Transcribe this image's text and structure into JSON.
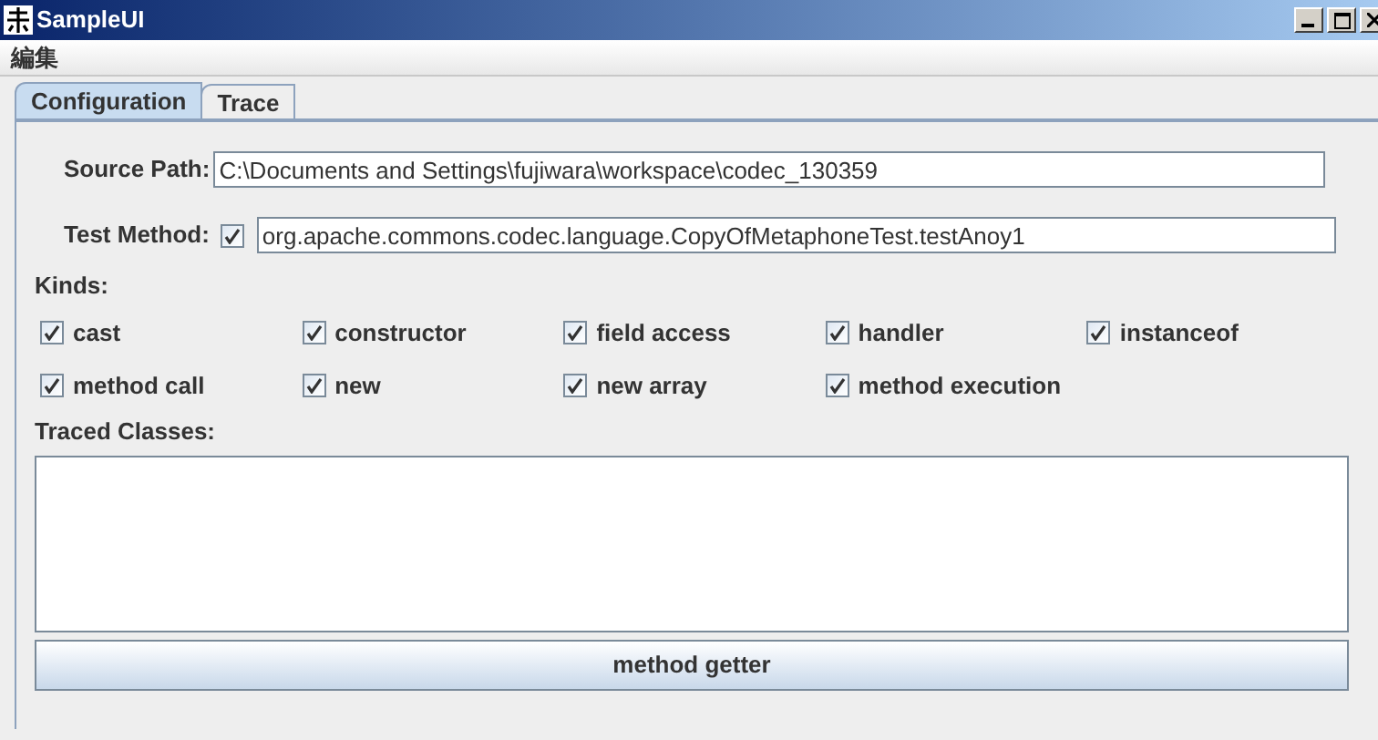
{
  "window": {
    "title": "SampleUI"
  },
  "menu": [
    "編集"
  ],
  "tabs": [
    {
      "label": "Configuration",
      "selected": true
    },
    {
      "label": "Trace",
      "selected": false
    }
  ],
  "source_path": {
    "label": "Source Path:",
    "value": "C:\\Documents and Settings\\fujiwara\\workspace\\codec_130359"
  },
  "test_method": {
    "label": "Test Method:",
    "checked": true,
    "value": "org.apache.commons.codec.language.CopyOfMetaphoneTest.testAnoy1"
  },
  "kinds": {
    "label": "Kinds:",
    "items": [
      {
        "label": "cast",
        "checked": true
      },
      {
        "label": "constructor",
        "checked": true
      },
      {
        "label": "field access",
        "checked": true
      },
      {
        "label": "handler",
        "checked": true
      },
      {
        "label": "instanceof",
        "checked": true
      },
      {
        "label": "method call",
        "checked": true
      },
      {
        "label": "new",
        "checked": true
      },
      {
        "label": "new array",
        "checked": true
      },
      {
        "label": "method execution",
        "checked": true
      }
    ]
  },
  "traced_classes": {
    "label": "Traced Classes:"
  },
  "button": "method getter"
}
